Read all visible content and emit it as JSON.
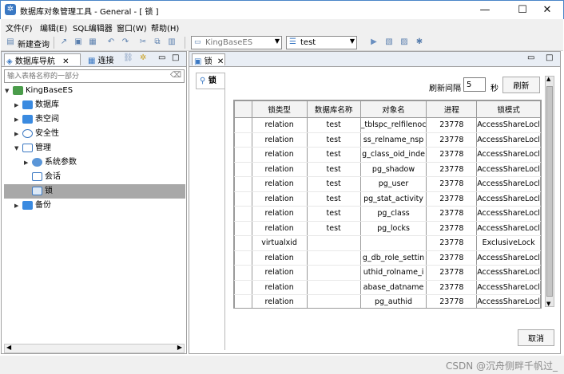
{
  "window": {
    "title": "数据库对象管理工具 - General - [ 锁 ]",
    "controls": {
      "minimize": "—",
      "maximize": "☐",
      "close": "✕"
    }
  },
  "menu": [
    "文件(F)",
    "编辑(E)",
    "SQL编辑器",
    "窗口(W)",
    "帮助(H)"
  ],
  "toolbar": {
    "new_query_label": "新建查询",
    "server_combo": "KingBaseES",
    "db_combo": "test"
  },
  "left_panel": {
    "tab_label": "数据库导航",
    "tab_connect_label": "连接",
    "filter_placeholder": "输入表格名称的一部分",
    "tree": {
      "root": "KingBaseES",
      "database": "数据库",
      "tablespace": "表空间",
      "security": "安全性",
      "manage": "管理",
      "sys_params": "系统参数",
      "sessions": "会话",
      "locks": "锁",
      "backup": "备份"
    }
  },
  "right_panel": {
    "tab_label": "锁",
    "inner_tab_label": "锁",
    "refresh_interval_label": "刷新间隔",
    "refresh_interval_value": "5",
    "seconds_label": "秒",
    "refresh_button": "刷新",
    "cancel_button": "取消"
  },
  "table": {
    "columns": [
      "",
      "锁类型",
      "数据库名称",
      "对象名",
      "进程",
      "锁模式"
    ],
    "rows": [
      [
        "",
        "relation",
        "test",
        "_tblspc_relfilenoc",
        "23778",
        "AccessShareLocl"
      ],
      [
        "",
        "relation",
        "test",
        "ss_relname_nsp",
        "23778",
        "AccessShareLocl"
      ],
      [
        "",
        "relation",
        "test",
        "g_class_oid_inde",
        "23778",
        "AccessShareLocl"
      ],
      [
        "",
        "relation",
        "test",
        "pg_shadow",
        "23778",
        "AccessShareLocl"
      ],
      [
        "",
        "relation",
        "test",
        "pg_user",
        "23778",
        "AccessShareLocl"
      ],
      [
        "",
        "relation",
        "test",
        "pg_stat_activity",
        "23778",
        "AccessShareLocl"
      ],
      [
        "",
        "relation",
        "test",
        "pg_class",
        "23778",
        "AccessShareLocl"
      ],
      [
        "",
        "relation",
        "test",
        "pg_locks",
        "23778",
        "AccessShareLocl"
      ],
      [
        "",
        "virtualxid",
        "",
        "",
        "23778",
        "ExclusiveLock"
      ],
      [
        "",
        "relation",
        "",
        "g_db_role_settin",
        "23778",
        "AccessShareLocl"
      ],
      [
        "",
        "relation",
        "",
        "uthid_rolname_i",
        "23778",
        "AccessShareLocl"
      ],
      [
        "",
        "relation",
        "",
        "abase_datname",
        "23778",
        "AccessShareLocl"
      ],
      [
        "",
        "relation",
        "",
        "pg_authid",
        "23778",
        "AccessShareLocl"
      ]
    ]
  },
  "watermark": "CSDN @沉舟侧畔千帆过_"
}
